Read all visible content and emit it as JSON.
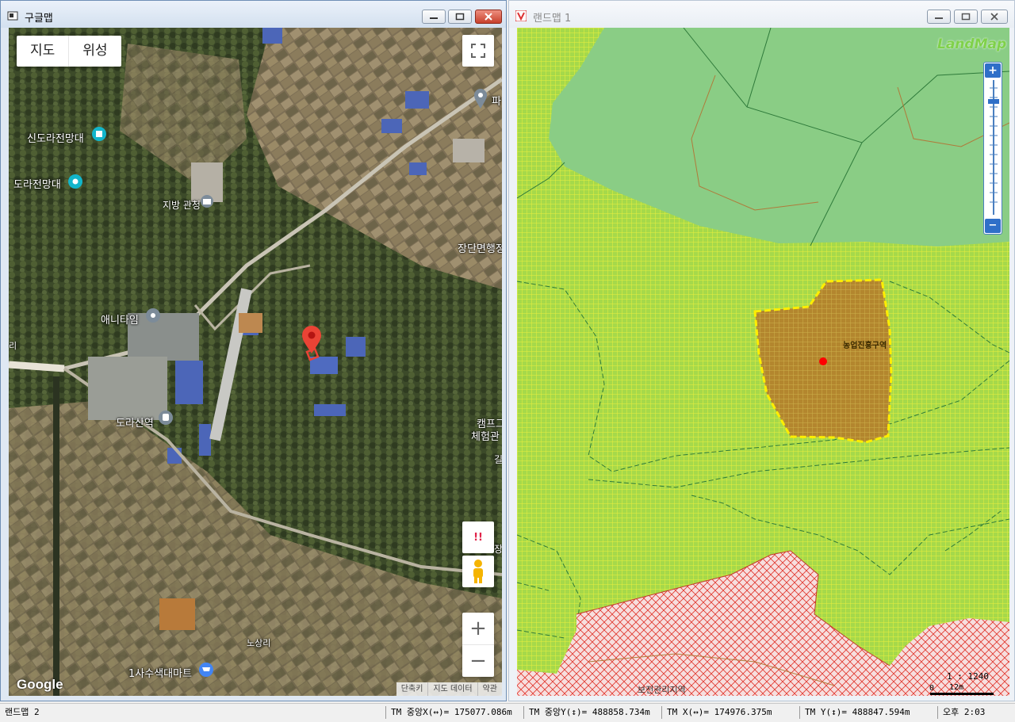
{
  "google_window": {
    "title": "구글맵",
    "map_type": {
      "map": "지도",
      "satellite": "위성"
    },
    "labels": {
      "sindora": "신도라전망대",
      "dora_obs": "도라전망대",
      "jibang": "지방 관청",
      "jangdan": "장단면행정",
      "pa": "파",
      "anytime": "애니타임",
      "ri": "리",
      "dorasan": "도라산역",
      "camp": "캠프그",
      "exp": "체험관",
      "gil": "길",
      "jang": "장",
      "nosangri": "노상리",
      "mart": "1사수색대마트"
    },
    "footer": {
      "shortcut": "단축키",
      "mapdata": "지도 데이터",
      "terms": "약관"
    },
    "logo": "Google",
    "buttons": {
      "alert": "!!",
      "zoom_in": "+",
      "zoom_out": "−"
    }
  },
  "land_window": {
    "title": "랜드맵 1",
    "logo": "LandMap",
    "parcel_label": "농업진흥구역",
    "zone_label": "보전관리지역",
    "scale": "1 : 1240",
    "scale_bar": {
      "min": "0",
      "max": "12m"
    }
  },
  "status": {
    "name": "랜드맵 2",
    "cx": "TM 중앙X(↔)= 175077.086m",
    "cy": "TM 중앙Y(↕)= 488858.734m",
    "x": "TM X(↔)= 174976.375m",
    "y": "TM Y(↕)= 488847.594m",
    "time": "오후 2:03"
  },
  "colors": {
    "agri_zone": "#a6d94a",
    "forest_zone": "#8acd85",
    "parcel": "#b3862e",
    "conservation_hatch": "#e0352b",
    "parcel_outline": "#ffee00"
  }
}
